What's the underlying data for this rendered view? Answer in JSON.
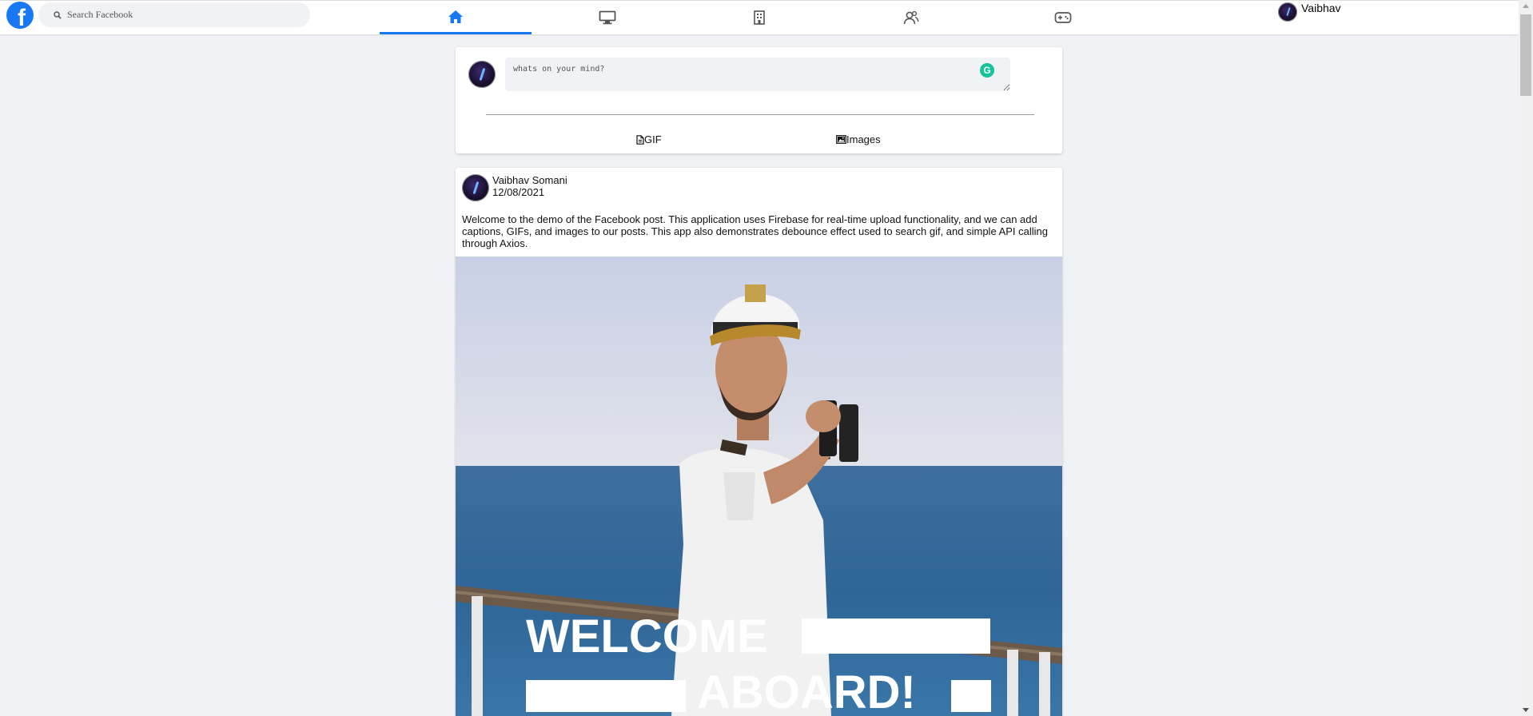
{
  "header": {
    "search": {
      "placeholder": "Search Facebook"
    },
    "nav_tabs": [
      {
        "name": "home",
        "icon": "home-icon",
        "active": true
      },
      {
        "name": "watch",
        "icon": "monitor-icon",
        "active": false
      },
      {
        "name": "marketplace",
        "icon": "building-icon",
        "active": false
      },
      {
        "name": "groups",
        "icon": "people-icon",
        "active": false
      },
      {
        "name": "gaming",
        "icon": "gamepad-icon",
        "active": false
      }
    ],
    "profile_name": "Vaibhav"
  },
  "composer": {
    "placeholder": "whats on your mind?",
    "gif_label": "GIF",
    "images_label": "Images"
  },
  "post": {
    "author": "Vaibhav Somani",
    "date": "12/08/2021",
    "caption": "Welcome to the demo of the Facebook post. This application uses Firebase for real-time upload functionality, and we can add captions, GIFs, and images to our posts. This app also demonstrates debounce effect used to search gif, and simple API calling through Axios.",
    "image_text_line1": "WELCOME",
    "image_text_line2": "ABOARD!"
  },
  "colors": {
    "brand": "#1877f2",
    "background": "#f0f2f5",
    "grammarly": "#15c39a"
  }
}
